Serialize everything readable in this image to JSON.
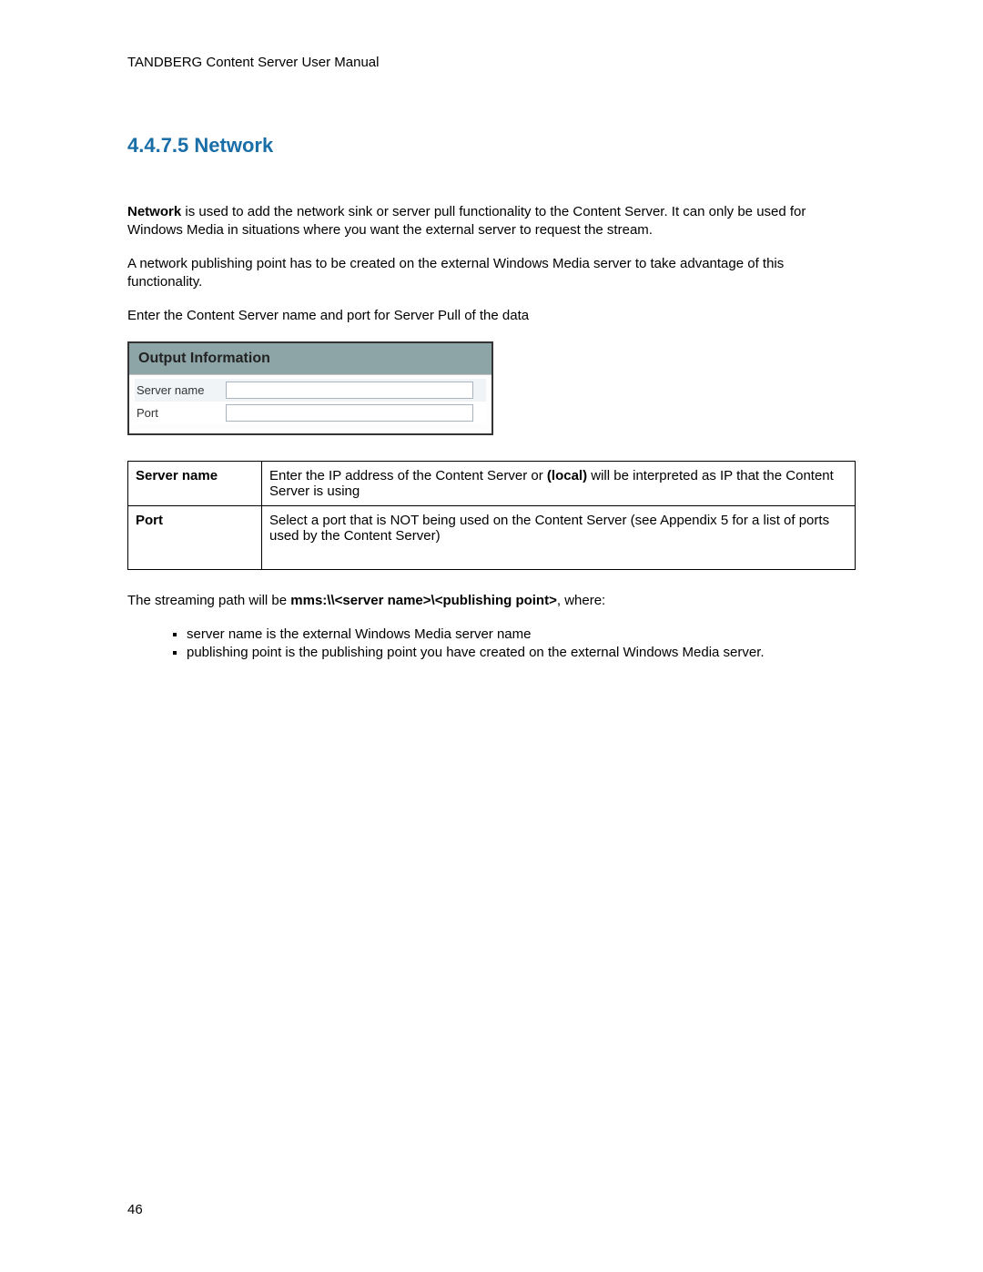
{
  "header": {
    "doc_title": "TANDBERG Content Server User Manual"
  },
  "section": {
    "number": "4.4.7.5",
    "title": "Network"
  },
  "paragraphs": {
    "p1_prefix": "Network",
    "p1_rest": " is used to add the network sink or server pull functionality to the Content Server. It can only be used for Windows Media in situations where you want the external server to request the stream.",
    "p2": "A network publishing point has to be created on the external Windows Media server to take advantage of this functionality.",
    "p3": "Enter the Content Server name and port for Server Pull of the data"
  },
  "screenshot": {
    "panel_title": "Output Information",
    "rows": [
      {
        "label": "Server name",
        "value": ""
      },
      {
        "label": "Port",
        "value": ""
      }
    ]
  },
  "def_table": {
    "rows": [
      {
        "term": "Server name",
        "desc_pre": "Enter the IP address of the Content Server or ",
        "desc_bold": "(local)",
        "desc_post": " will be interpreted as IP that the Content Server is using"
      },
      {
        "term": "Port",
        "desc": "Select a port that is NOT being used on the Content Server (see Appendix 5 for a list of ports used by the Content Server)"
      }
    ]
  },
  "stream_path": {
    "pre": "The streaming path will be ",
    "bold": "mms:\\\\<server name>\\<publishing point>",
    "post": ", where:"
  },
  "bullets": [
    "server name is the external Windows Media server name",
    "publishing point is the publishing point you have created on the external Windows Media server."
  ],
  "page_number": "46"
}
